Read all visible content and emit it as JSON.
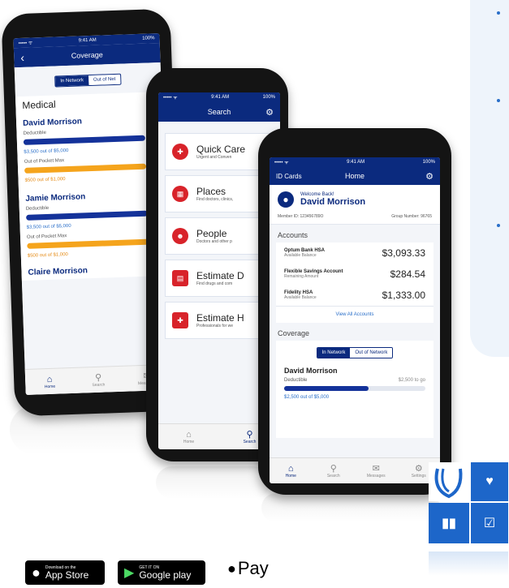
{
  "phone1": {
    "status_left": "••••• ᯤ",
    "status_time": "9:41 AM",
    "status_right": "100%",
    "title": "Coverage",
    "seg_in": "In Network",
    "seg_out": "Out of Net",
    "section": "Medical",
    "members": [
      {
        "name": "David Morrison",
        "deductible_label": "Deductible",
        "deductible_amount": "$3,500 out of $5,000",
        "oop_label": "Out of Pocket Max",
        "oop_amount": "$500 out of $1,000"
      },
      {
        "name": "Jamie Morrison",
        "deductible_label": "Deductible",
        "deductible_amount": "$3,500 out of $5,000",
        "oop_label": "Out of Pocket Max",
        "oop_amount": "$500 out of $1,000"
      }
    ],
    "cut_name": "Claire Morrison",
    "tabs": [
      "Home",
      "Search",
      "Messages"
    ]
  },
  "phone2": {
    "status_left": "••••• ᯤ",
    "status_time": "9:41 AM",
    "status_right": "100%",
    "title": "Search",
    "items": [
      {
        "title": "Quick Care",
        "sub": "Urgent and Conven"
      },
      {
        "title": "Places",
        "sub": "Find doctors, clinics,"
      },
      {
        "title": "People",
        "sub": "Doctors and other p"
      },
      {
        "title": "Estimate D",
        "sub": "Find drugs and com"
      },
      {
        "title": "Estimate H",
        "sub": "Professionals for we"
      }
    ],
    "tabs": [
      "Home",
      "Search"
    ]
  },
  "phone3": {
    "status_left": "••••• ᯤ",
    "status_time": "9:41 AM",
    "status_right": "100%",
    "left_label": "ID Cards",
    "title": "Home",
    "welcome": "Welcome Back!",
    "name": "David Morrison",
    "member_id": "Member ID: 123456789O",
    "group_number": "Group Number: 96765",
    "accounts_title": "Accounts",
    "accounts": [
      {
        "name": "Optum Bank HSA",
        "sub": "Available Balance",
        "value": "$3,093.33"
      },
      {
        "name": "Flexible Savings Account",
        "sub": "Remaining Amount",
        "value": "$284.54"
      },
      {
        "name": "Fidelity HSA",
        "sub": "Available Balance",
        "value": "$1,333.00"
      }
    ],
    "view_all": "View All Accounts",
    "coverage_title": "Coverage",
    "seg_in": "In Network",
    "seg_out": "Out of Network",
    "cov_name": "David Morrison",
    "cov_label": "Deductible",
    "cov_togo": "$2,500 to go",
    "cov_amount": "$2,500 out of $5,000",
    "tabs": [
      "Home",
      "Search",
      "Messages",
      "Settings"
    ]
  },
  "badges": {
    "appstore_small": "Download on the",
    "appstore_large": "App Store",
    "google_small": "GET IT ON",
    "google_large": "Google play",
    "applepay": "Pay"
  },
  "colors": {
    "navy": "#0b2a7e",
    "red": "#d8232a",
    "orange": "#f5a41c",
    "tile_blue": "#1d66c9"
  }
}
